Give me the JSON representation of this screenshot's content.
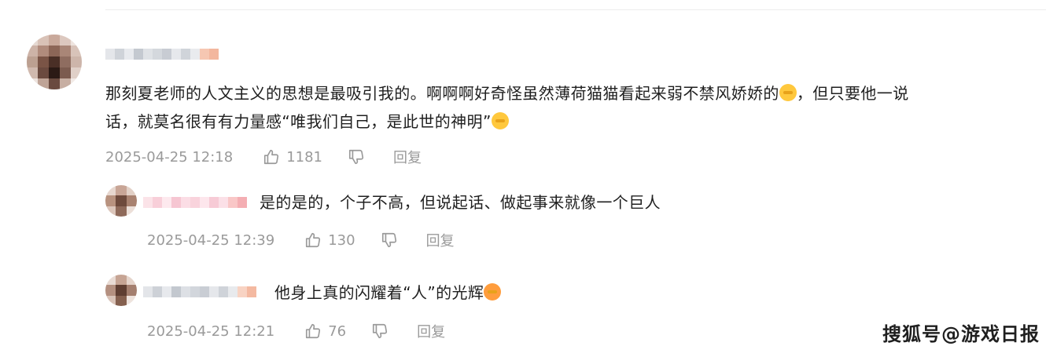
{
  "comments": [
    {
      "text": "那刻夏老师的人文主义的思想是最吸引我的。啊啊啊好奇怪虽然薄荷猫猫看起来弱不禁风娇娇的🫣，但只要他一说话，就莫名很有有力量感“唯我们自己，是此世的神明”🫢",
      "line1": "那刻夏老师的人文主义的思想是最吸引我的。啊啊啊好奇怪虽然薄荷猫猫看起来弱不禁风娇娇的",
      "line1b": "，但只要他一说",
      "line2": "话，就莫名很有有力量感“唯我们自己，是此世的神明”",
      "date": "2025-04-25 12:18",
      "likes": "1181",
      "reply_label": "回复"
    },
    {
      "text": "是的是的，个子不高，但说起话、做起事来就像一个巨人",
      "date": "2025-04-25 12:39",
      "likes": "130",
      "reply_label": "回复"
    },
    {
      "text": "他身上真的闪耀着“人”的光辉",
      "date": "2025-04-25 12:21",
      "likes": "76",
      "reply_label": "回复"
    }
  ],
  "watermark": "搜狐号@游戏日报",
  "icons": [
    "thumb-up-icon",
    "thumb-down-icon",
    "emoji-icon"
  ],
  "colors": {
    "meta_gray": "#9a9a9a",
    "text": "#1f1f1f",
    "divider": "#ececec"
  }
}
